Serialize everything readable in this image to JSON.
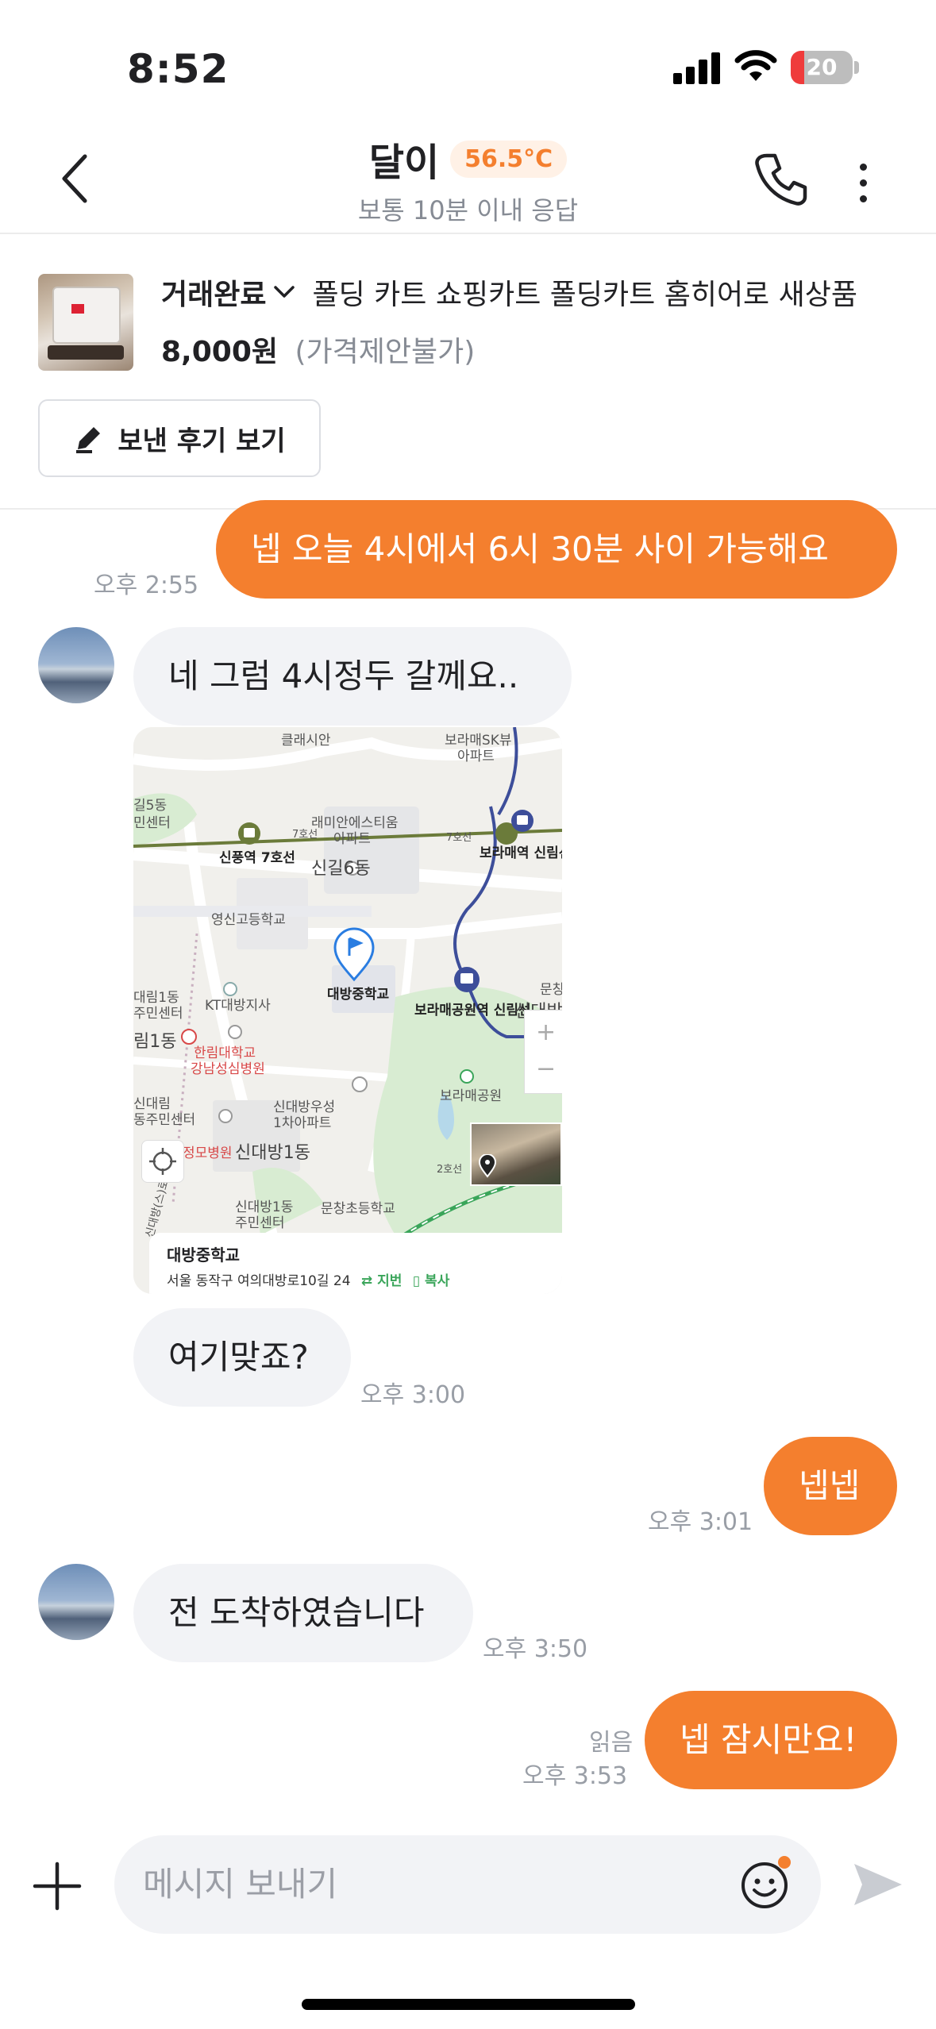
{
  "status_bar": {
    "time": "8:52",
    "battery": "20"
  },
  "header": {
    "title": "달이",
    "temperature": "56.5°C",
    "subtitle": "보통 10분 이내 응답"
  },
  "product": {
    "status": "거래완료",
    "title": "폴딩 카트 쇼핑카트 폴딩카트 홈히어로 새상품",
    "price": "8,000원",
    "price_note": "(가격제안불가)",
    "review_button": "보낸 후기 보기"
  },
  "messages": {
    "m1": {
      "text": "넵 오늘 4시에서 6시 30분 사이 가능해요",
      "time": "오후 2:55"
    },
    "m2": {
      "text": "네 그럼 4시정두 갈께요.."
    },
    "m3": {
      "text": "여기맞죠?",
      "time": "오후 3:00"
    },
    "m4": {
      "text": "넵넵",
      "time": "오후 3:01"
    },
    "m5": {
      "text": "전 도착하였습니다",
      "time": "오후 3:50"
    },
    "m6": {
      "text": "넵 잠시만요!",
      "time": "오후 3:53",
      "read": "읽음"
    }
  },
  "map": {
    "place_name": "대방중학교",
    "address": "서울 동작구 여의대방로10길 24",
    "jibun": "⇄ 지번",
    "copy": "▯ 복사",
    "labels": {
      "l1": "클래시안",
      "l2": "보라매SK뷰",
      "l3": "아파트",
      "l4": "길5동",
      "l5": "민센터",
      "l6": "래미안에스티움",
      "l7": "아파트",
      "l8": "신풍역 7호선",
      "l9": "보라매역 신림선",
      "l10": "신길6동",
      "l11": "영신고등학교",
      "l12": "대림1동",
      "l13": "주민센터",
      "l14": "KT대방지사",
      "l15": "대방중학교",
      "l16": "보라매공원역 신림선",
      "l17": "문창",
      "l18": "림1동",
      "l19": "한림대학교",
      "l20": "강남성심병원",
      "l21": "보라매공원",
      "l22": "신대림",
      "l23": "동주민센터",
      "l24": "신대방우성",
      "l25": "1차아파트",
      "l26": "신대방1동",
      "l27": "정모병원",
      "l28": "신대방1동",
      "l29": "주민센터",
      "l30": "문창초등학교",
      "l31": "7호선",
      "l32": "7호선",
      "l33": "2호선",
      "l34": "신대방",
      "l35": "신대방(스)로"
    }
  },
  "input": {
    "placeholder": "메시지 보내기"
  }
}
